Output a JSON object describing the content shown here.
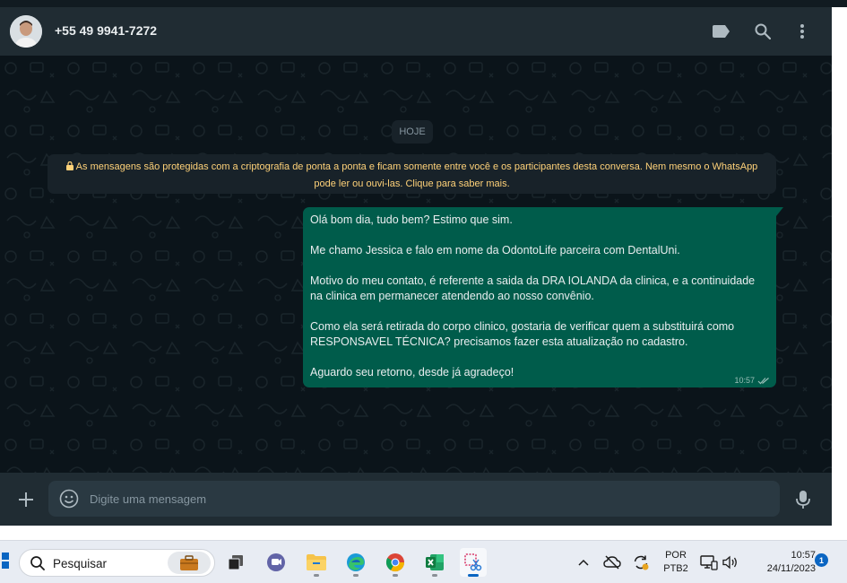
{
  "header": {
    "contact_name": "+55 49 9941-7272",
    "icons": [
      "label-icon",
      "search-icon",
      "more-vertical-icon"
    ]
  },
  "chat": {
    "date_chip": "HOJE",
    "encryption_notice_line1": "As mensagens são protegidas com a criptografia de ponta a ponta e ficam somente entre você e os participantes desta conversa. Nem mesmo o WhatsApp",
    "encryption_notice_line2": "pode ler ou ouvi-las. Clique para saber mais.",
    "message": {
      "paragraphs": [
        "Olá bom dia, tudo bem? Estimo que sim.",
        "Me chamo Jessica e falo em nome da OdontoLife parceira com DentalUni.",
        "Motivo do meu contato, é referente a saida da DRA IOLANDA da clinica, e a continuidade na clinica em permanecer atendendo ao nosso convênio.",
        "Como ela será retirada do corpo clinico, gostaria de verificar quem a substituirá como RESPONSAVEL TÉCNICA? precisamos fazer esta atualização no cadastro.",
        "Aguardo seu retorno, desde já agradeço!"
      ],
      "time": "10:57",
      "status": "read"
    }
  },
  "composer": {
    "placeholder": "Digite uma mensagem"
  },
  "taskbar": {
    "search_placeholder": "Pesquisar",
    "lang_line1": "POR",
    "lang_line2": "PTB2",
    "time": "10:57",
    "date": "24/11/2023",
    "notification_count": "1"
  },
  "colors": {
    "header_bg": "#202c33",
    "chat_bg": "#0b141a",
    "bubble_out": "#005c4b",
    "notice_text": "#ffd279"
  }
}
